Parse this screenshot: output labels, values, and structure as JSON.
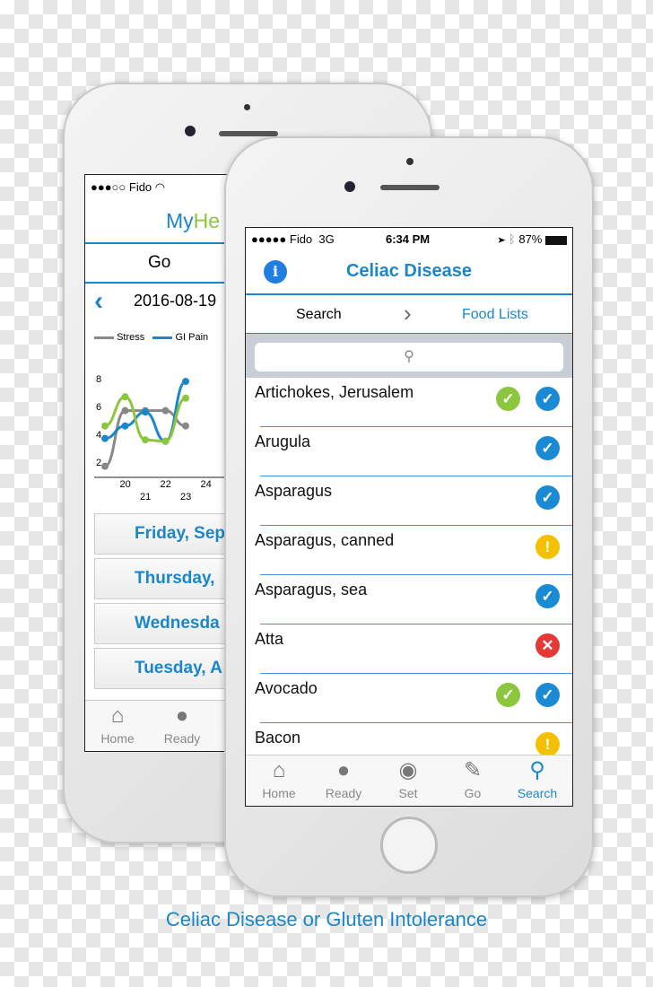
{
  "back_phone": {
    "status": {
      "carrier": "●●●○○ Fido",
      "wifi_icon": "wifi-icon"
    },
    "title_my": "My",
    "title_he": "He",
    "segment": "Go",
    "date": "2016-08-19",
    "legend": [
      {
        "name": "Stress",
        "color": "#888888"
      },
      {
        "name": "GI Pain",
        "color": "#1b87c9"
      }
    ],
    "chart_data": {
      "type": "line",
      "x": [
        19,
        20,
        21,
        22,
        23
      ],
      "yticks": [
        "2",
        "4",
        "6",
        "8"
      ],
      "xticks_top": [
        "20",
        "22",
        "24"
      ],
      "xticks_bottom": [
        "21",
        "23"
      ],
      "ylim": [
        1,
        9
      ],
      "series": [
        {
          "name": "Stress",
          "color": "#888888",
          "values": [
            1.7,
            5.7,
            5.7,
            5.7,
            4.6
          ]
        },
        {
          "name": "GI Pain",
          "color": "#1b87c9",
          "values": [
            3.7,
            4.6,
            5.6,
            3.5,
            7.8
          ]
        },
        {
          "color": "#8cc63f",
          "values": [
            4.6,
            6.7,
            3.6,
            3.5,
            6.6
          ]
        }
      ]
    },
    "days": [
      "Friday, Sep",
      "Thursday,",
      "Wednesda",
      "Tuesday, A"
    ],
    "tabs": [
      {
        "label": "Home",
        "icon": "home-icon"
      },
      {
        "label": "Ready",
        "icon": "apple-icon"
      }
    ]
  },
  "front_phone": {
    "status": {
      "carrier": "●●●●● Fido",
      "network": "3G",
      "time": "6:34 PM",
      "battery": "87%"
    },
    "title": "Celiac Disease",
    "breadcrumb": {
      "current": "Search",
      "next": "Food Lists"
    },
    "search": {
      "placeholder": ""
    },
    "foods": [
      {
        "name": "Artichokes, Jerusalem",
        "icons": [
          "green-check",
          "blue-check"
        ]
      },
      {
        "name": "Arugula",
        "icons": [
          "blue-check"
        ]
      },
      {
        "name": "Asparagus",
        "icons": [
          "blue-check"
        ]
      },
      {
        "name": "Asparagus, canned",
        "icons": [
          "warning"
        ]
      },
      {
        "name": "Asparagus, sea",
        "icons": [
          "blue-check"
        ]
      },
      {
        "name": "Atta",
        "icons": [
          "red-x"
        ]
      },
      {
        "name": "Avocado",
        "icons": [
          "green-check",
          "blue-check"
        ]
      },
      {
        "name": "Bacon",
        "icons": [
          "warning"
        ]
      }
    ],
    "tabs": [
      {
        "label": "Home",
        "icon": "home-icon"
      },
      {
        "label": "Ready",
        "icon": "apple-icon"
      },
      {
        "label": "Set",
        "icon": "plate-icon"
      },
      {
        "label": "Go",
        "icon": "notebook-pencil-icon"
      },
      {
        "label": "Search",
        "icon": "search-icon",
        "active": true
      }
    ]
  },
  "caption": "Celiac Disease or Gluten Intolerance",
  "colors": {
    "accent": "#1b87c9",
    "green": "#8cc63f",
    "check_blue": "#1a8ad4",
    "warning": "#f5c000",
    "error": "#e53935"
  }
}
